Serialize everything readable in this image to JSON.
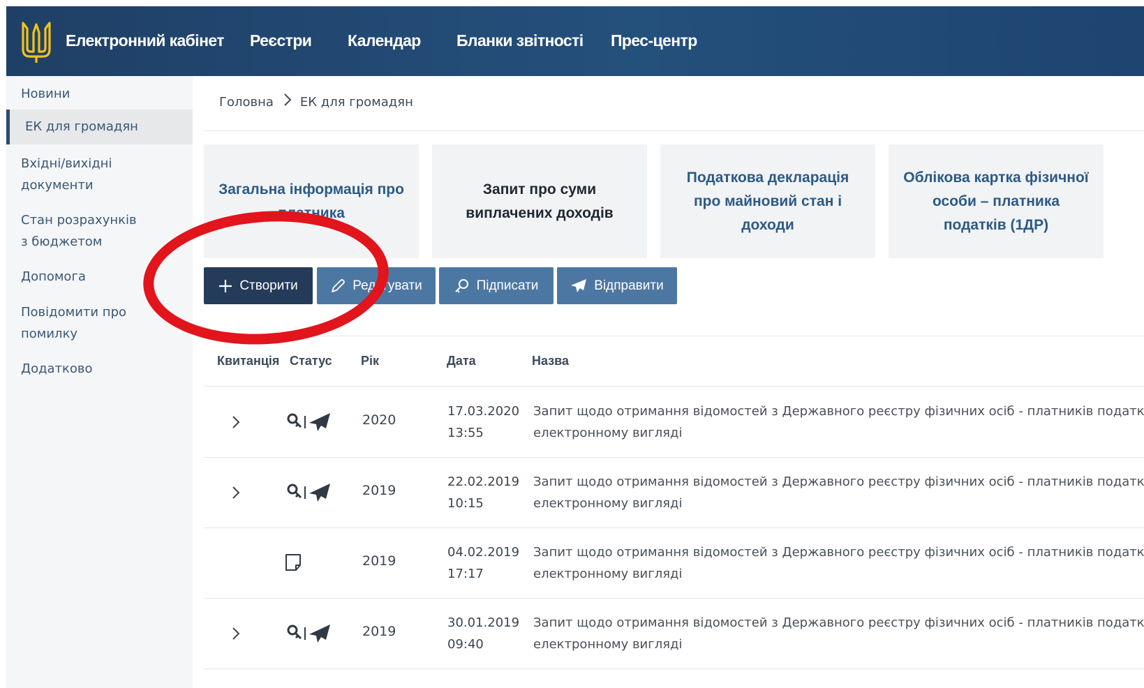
{
  "header": {
    "brand": "Електронний кабінет",
    "nav": [
      "Реєстри",
      "Календар",
      "Бланки звітності",
      "Прес-центр"
    ]
  },
  "sidebar": {
    "items": [
      {
        "label": "Новини",
        "active": false
      },
      {
        "label": "ЕК для громадян",
        "active": true
      },
      {
        "label": "Вхідні/вихідні документи",
        "active": false
      },
      {
        "label": "Стан розрахунків з бюджетом",
        "active": false
      },
      {
        "label": "Допомога",
        "active": false
      },
      {
        "label": "Повідомити про помилку",
        "active": false
      },
      {
        "label": "Додатково",
        "active": false
      }
    ]
  },
  "breadcrumb": {
    "home": "Головна",
    "current": "ЕК для громадян"
  },
  "cards": [
    "Загальна інформація про платника",
    "Запит про суми виплачених доходів",
    "Податкова декларація про майновий стан і доходи",
    "Облікова картка фізичної особи – платника податків (1ДР)"
  ],
  "toolbar": {
    "create": "Створити",
    "edit": "Редагувати",
    "sign": "Підписати",
    "send": "Відправити"
  },
  "table": {
    "columns": [
      "Квитанція",
      "Статус",
      "Рік",
      "Дата",
      "Назва"
    ],
    "rows": [
      {
        "year": "2020",
        "date": "17.03.2020",
        "time": "13:55",
        "title": "Запит щодо отримання відомостей з Державного реєстру фізичних осіб - платників податків в",
        "title2": "електронному вигляді",
        "status": "signed-sent",
        "expandable": true
      },
      {
        "year": "2019",
        "date": "22.02.2019",
        "time": "10:15",
        "title": "Запит щодо отримання відомостей з Державного реєстру фізичних осіб - платників податків в",
        "title2": "електронному вигляді",
        "status": "signed-sent",
        "expandable": true
      },
      {
        "year": "2019",
        "date": "04.02.2019",
        "time": "17:17",
        "title": "Запит щодо отримання відомостей з Державного реєстру фізичних осіб - платників податків в",
        "title2": "електронному вигляді",
        "status": "draft",
        "expandable": false
      },
      {
        "year": "2019",
        "date": "30.01.2019",
        "time": "09:40",
        "title": "Запит щодо отримання відомостей з Державного реєстру фізичних осіб - платників податків в",
        "title2": "електронному вигляді",
        "status": "signed-sent",
        "expandable": true
      }
    ]
  },
  "colors": {
    "header": "#1f3f66",
    "primary_button": "#243b59",
    "secondary_button": "#4d77a3",
    "link": "#2b5a86",
    "annotation": "#e2141c"
  }
}
